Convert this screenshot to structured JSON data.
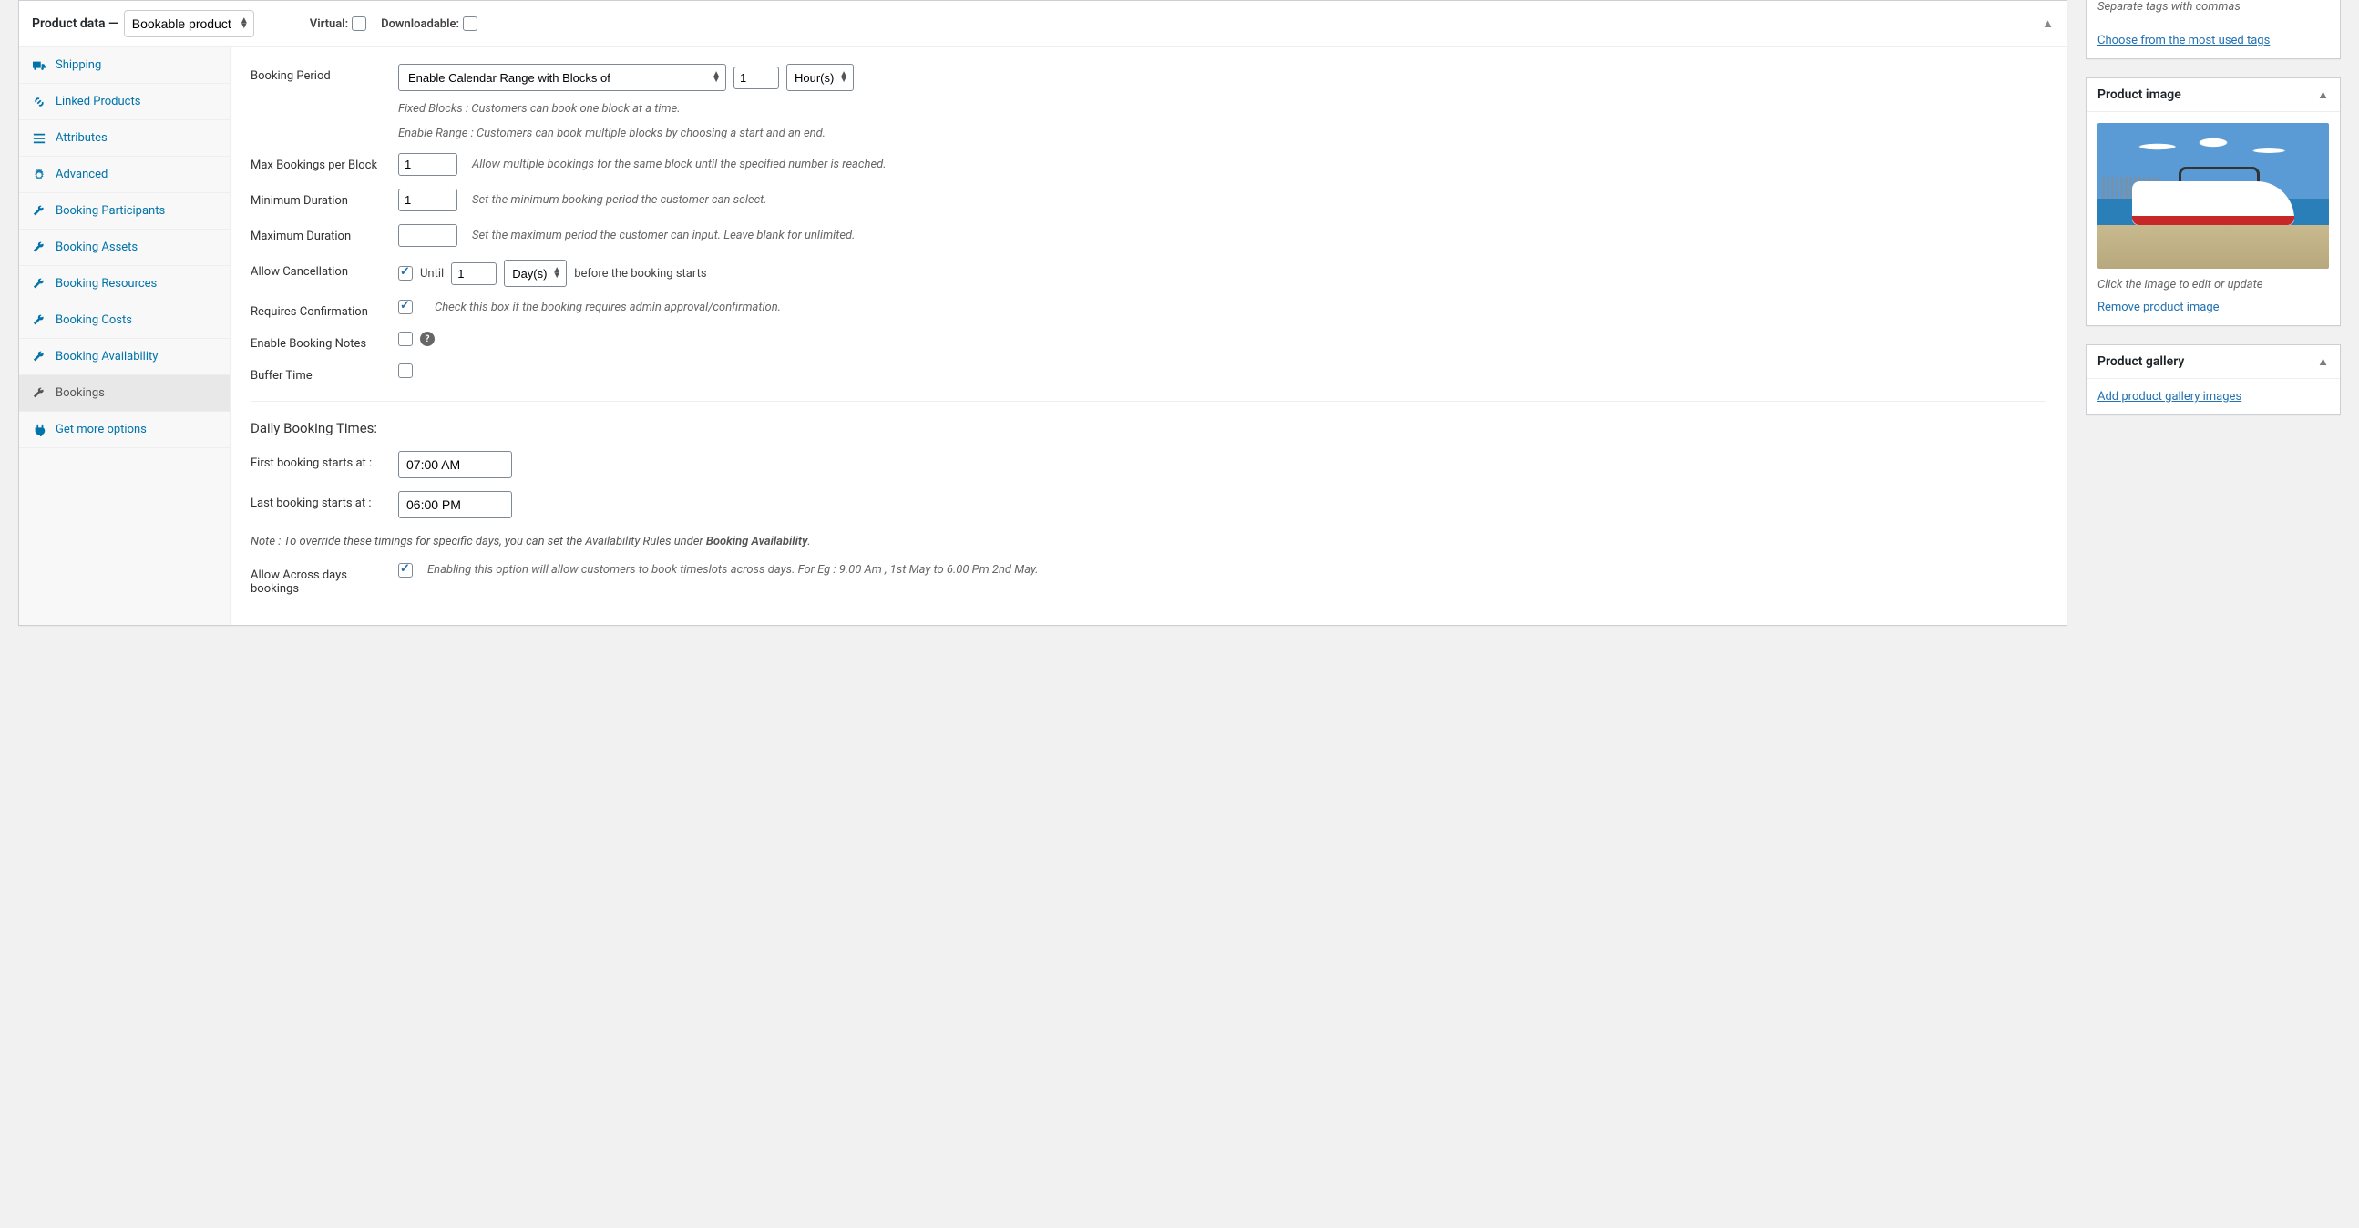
{
  "panel": {
    "title": "Product data —",
    "productType": "Bookable product",
    "virtualLabel": "Virtual:",
    "downloadableLabel": "Downloadable:"
  },
  "tabs": {
    "shipping": "Shipping",
    "linkedProducts": "Linked Products",
    "attributes": "Attributes",
    "advanced": "Advanced",
    "bookingParticipants": "Booking Participants",
    "bookingAssets": "Booking Assets",
    "bookingResources": "Booking Resources",
    "bookingCosts": "Booking Costs",
    "bookingAvailability": "Booking Availability",
    "bookings": "Bookings",
    "getMoreOptions": "Get more options"
  },
  "form": {
    "bookingPeriod": {
      "label": "Booking Period",
      "select": "Enable Calendar Range with Blocks of",
      "value": "1",
      "unit": "Hour(s)",
      "hint1": "Fixed Blocks : Customers can book one block at a time.",
      "hint2": "Enable Range : Customers can book multiple blocks by choosing a start and an end."
    },
    "maxBookings": {
      "label": "Max Bookings per Block",
      "value": "1",
      "hint": "Allow multiple bookings for the same block until the specified number is reached."
    },
    "minDuration": {
      "label": "Minimum Duration",
      "value": "1",
      "hint": "Set the minimum booking period the customer can select."
    },
    "maxDuration": {
      "label": "Maximum Duration",
      "value": "",
      "hint": "Set the maximum period the customer can input. Leave blank for unlimited."
    },
    "allowCancel": {
      "label": "Allow Cancellation",
      "until": "Until",
      "value": "1",
      "unit": "Day(s)",
      "suffix": "before the booking starts"
    },
    "reqConfirm": {
      "label": "Requires Confirmation",
      "hint": "Check this box if the booking requires admin approval/confirmation."
    },
    "bookingNotes": {
      "label": "Enable Booking Notes"
    },
    "bufferTime": {
      "label": "Buffer Time"
    },
    "sectionHeading": "Daily Booking Times:",
    "firstBooking": {
      "label": "First booking starts at :",
      "value": "07:00 AM"
    },
    "lastBooking": {
      "label": "Last booking starts at :",
      "value": "06:00 PM"
    },
    "note": {
      "prefix": "Note : To override these timings for specific days, you can set the Availability Rules under ",
      "bold": "Booking Availability",
      "suffix": "."
    },
    "allowAcross": {
      "label": "Allow Across days bookings",
      "hint": "Enabling this option will allow customers to book timeslots across days. For Eg : 9.00 Am , 1st May to 6.00 Pm 2nd May."
    }
  },
  "tagsBox": {
    "hint": "Separate tags with commas",
    "chooseLink": "Choose from the most used tags"
  },
  "productImage": {
    "title": "Product image",
    "editHint": "Click the image to edit or update",
    "removeLink": "Remove product image"
  },
  "productGallery": {
    "title": "Product gallery",
    "addLink": "Add product gallery images"
  }
}
